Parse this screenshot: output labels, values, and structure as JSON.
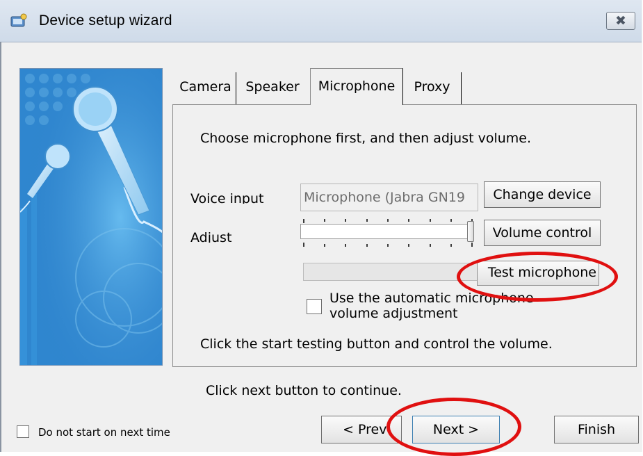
{
  "window": {
    "title": "Device setup wizard",
    "icon": "wizard-app-icon",
    "close_glyph": "✖"
  },
  "tabs": [
    {
      "label": "Camera",
      "selected": false
    },
    {
      "label": "Speaker",
      "selected": false
    },
    {
      "label": "Microphone",
      "selected": true
    },
    {
      "label": "Proxy",
      "selected": false
    }
  ],
  "microphone": {
    "instruction": "Choose microphone first, and then adjust volume.",
    "voice_input_label": "Voice input",
    "voice_input_value": "Microphone (Jabra GN19",
    "change_device_label": "Change device",
    "adjust_label": "Adjust",
    "volume_level": 1.0,
    "volume_control_label": "Volume control",
    "test_microphone_label": "Test microphone",
    "auto_adjust_label_line1": "Use the automatic microphone",
    "auto_adjust_label_line2": "volume adjustment",
    "auto_adjust_checked": false,
    "test_instruction": "Click the start testing button and control the volume."
  },
  "footer": {
    "hint": "Click next button to continue.",
    "do_not_start_label": "Do not start on next time",
    "do_not_start_checked": false,
    "prev_label": "< Prev",
    "next_label": "Next >",
    "finish_label": "Finish"
  },
  "colors": {
    "annotation": "#e01010",
    "banner_blue": "#2f86cf"
  }
}
